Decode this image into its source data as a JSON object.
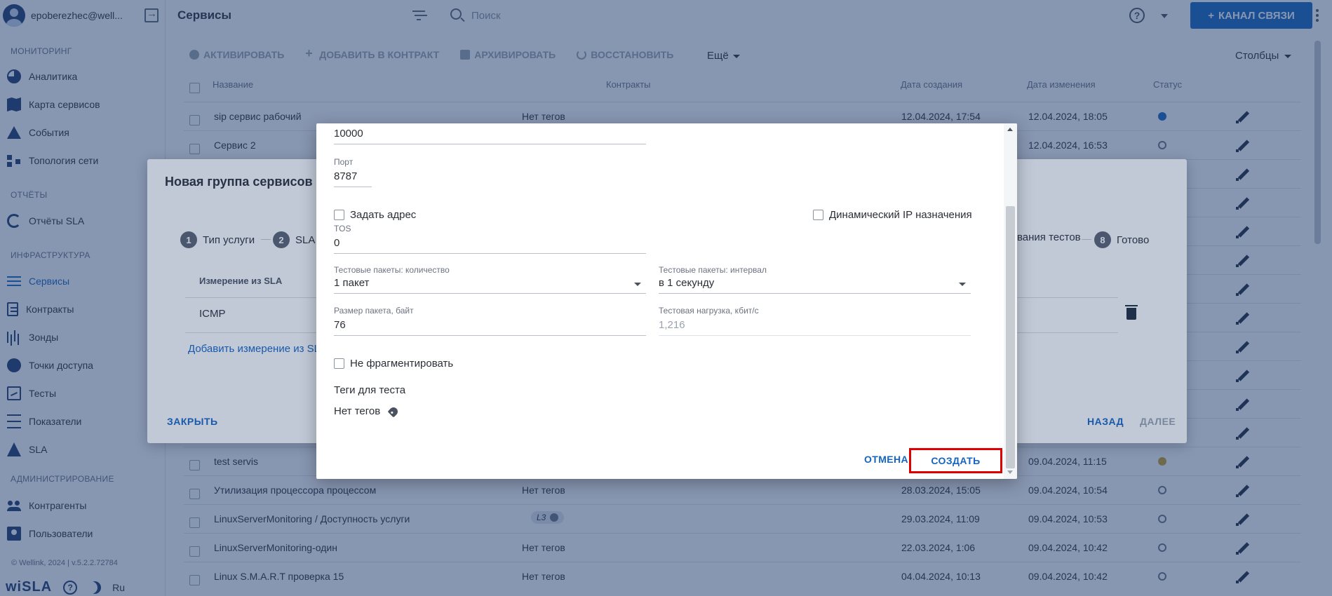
{
  "user": {
    "email": "epoberezhec@well..."
  },
  "sidebar": {
    "sections": [
      {
        "title": "МОНИТОРИНГ",
        "items": [
          {
            "label": "Аналитика",
            "icon": "pie-chart-icon"
          },
          {
            "label": "Карта сервисов",
            "icon": "map-icon"
          },
          {
            "label": "События",
            "icon": "warning-icon"
          },
          {
            "label": "Топология сети",
            "icon": "topology-icon"
          }
        ]
      },
      {
        "title": "ОТЧЁТЫ",
        "items": [
          {
            "label": "Отчёты SLA",
            "icon": "refresh-icon"
          }
        ]
      },
      {
        "title": "ИНФРАСТРУКТУРА",
        "items": [
          {
            "label": "Сервисы",
            "icon": "list-icon",
            "active": true
          },
          {
            "label": "Контракты",
            "icon": "document-icon"
          },
          {
            "label": "Зонды",
            "icon": "waveform-icon"
          },
          {
            "label": "Точки доступа",
            "icon": "access-point-icon"
          },
          {
            "label": "Тесты",
            "icon": "test-icon"
          },
          {
            "label": "Показатели",
            "icon": "gauge-icon"
          },
          {
            "label": "SLA",
            "icon": "sla-icon"
          }
        ]
      },
      {
        "title": "АДМИНИСТРИРОВАНИЕ",
        "items": [
          {
            "label": "Контрагенты",
            "icon": "people-icon"
          },
          {
            "label": "Пользователи",
            "icon": "user-card-icon"
          }
        ]
      }
    ],
    "footer": "© Wellink, 2024 | v.5.2.2.72784",
    "logo": "wiSLA",
    "lang": "Ru"
  },
  "header": {
    "title": "Сервисы",
    "search_placeholder": "Поиск",
    "channel_button": "КАНАЛ СВЯЗИ",
    "accent_color": "#1565c0"
  },
  "toolbar": {
    "activate": "АКТИВИРОВАТЬ",
    "add_to_contract": "ДОБАВИТЬ В КОНТРАКТ",
    "archive": "АРХИВИРОВАТЬ",
    "restore": "ВОССТАНОВИТЬ",
    "more": "Ещё",
    "columns": "Столбцы"
  },
  "table": {
    "headers": {
      "name": "Название",
      "contracts": "Контракты",
      "created": "Дата создания",
      "updated": "Дата изменения",
      "status": "Статус"
    },
    "rows": [
      {
        "name": "sip сервис рабочий",
        "tags": "Нет тегов",
        "created": "12.04.2024, 17:54",
        "updated": "12.04.2024, 18:05",
        "status": "active"
      },
      {
        "name": "Сервис 2",
        "tags": "",
        "created": "",
        "updated": "12.04.2024, 16:53",
        "status": "off"
      },
      {
        "name": "test servis",
        "tags": "",
        "created": "",
        "updated": "09.04.2024, 11:15",
        "status": "warning"
      },
      {
        "name": "Утилизация процессора процессом",
        "tags": "Нет тегов",
        "created": "28.03.2024, 15:05",
        "updated": "09.04.2024, 10:54",
        "status": "off"
      },
      {
        "name": "LinuxServerMonitoring / Доступность услуги",
        "tags": "L3",
        "created": "29.03.2024, 11:09",
        "updated": "09.04.2024, 10:53",
        "status": "off"
      },
      {
        "name": "LinuxServerMonitoring-один",
        "tags": "Нет тегов",
        "created": "22.03.2024, 1:06",
        "updated": "09.04.2024, 10:42",
        "status": "off"
      },
      {
        "name": "Linux S.M.A.R.T проверка 15",
        "tags": "Нет тегов",
        "created": "04.04.2024, 10:13",
        "updated": "09.04.2024, 10:42",
        "status": "off"
      }
    ]
  },
  "wizard": {
    "title": "Новая группа сервисов",
    "steps": [
      {
        "num": "1",
        "label": "Тип услуги"
      },
      {
        "num": "2",
        "label": "SLA"
      },
      {
        "num": "",
        "label": "вания тестов"
      },
      {
        "num": "8",
        "label": "Готово"
      }
    ],
    "sla_header": "Измерение из SLA",
    "sla_value": "ICMP",
    "add_link": "Добавить измерение из SL",
    "close": "ЗАКРЫТЬ",
    "back": "НАЗАД",
    "next": "ДАЛЕЕ"
  },
  "dialog": {
    "top_value": "10000",
    "port_label": "Порт",
    "port_value": "8787",
    "set_address": "Задать адрес",
    "dynamic_ip": "Динамический IP назначения",
    "tos_label": "TOS",
    "tos_value": "0",
    "packets_count_label": "Тестовые пакеты: количество",
    "packets_count_value": "1 пакет",
    "packets_interval_label": "Тестовые пакеты: интервал",
    "packets_interval_value": "в 1 секунду",
    "packet_size_label": "Размер пакета, байт",
    "packet_size_value": "76",
    "test_load_label": "Тестовая нагрузка, кбит/с",
    "test_load_value": "1,216",
    "no_fragment": "Не фрагментировать",
    "tags_title": "Теги для теста",
    "no_tags": "Нет тегов",
    "cancel": "ОТМЕНА",
    "create": "СОЗДАТЬ"
  }
}
